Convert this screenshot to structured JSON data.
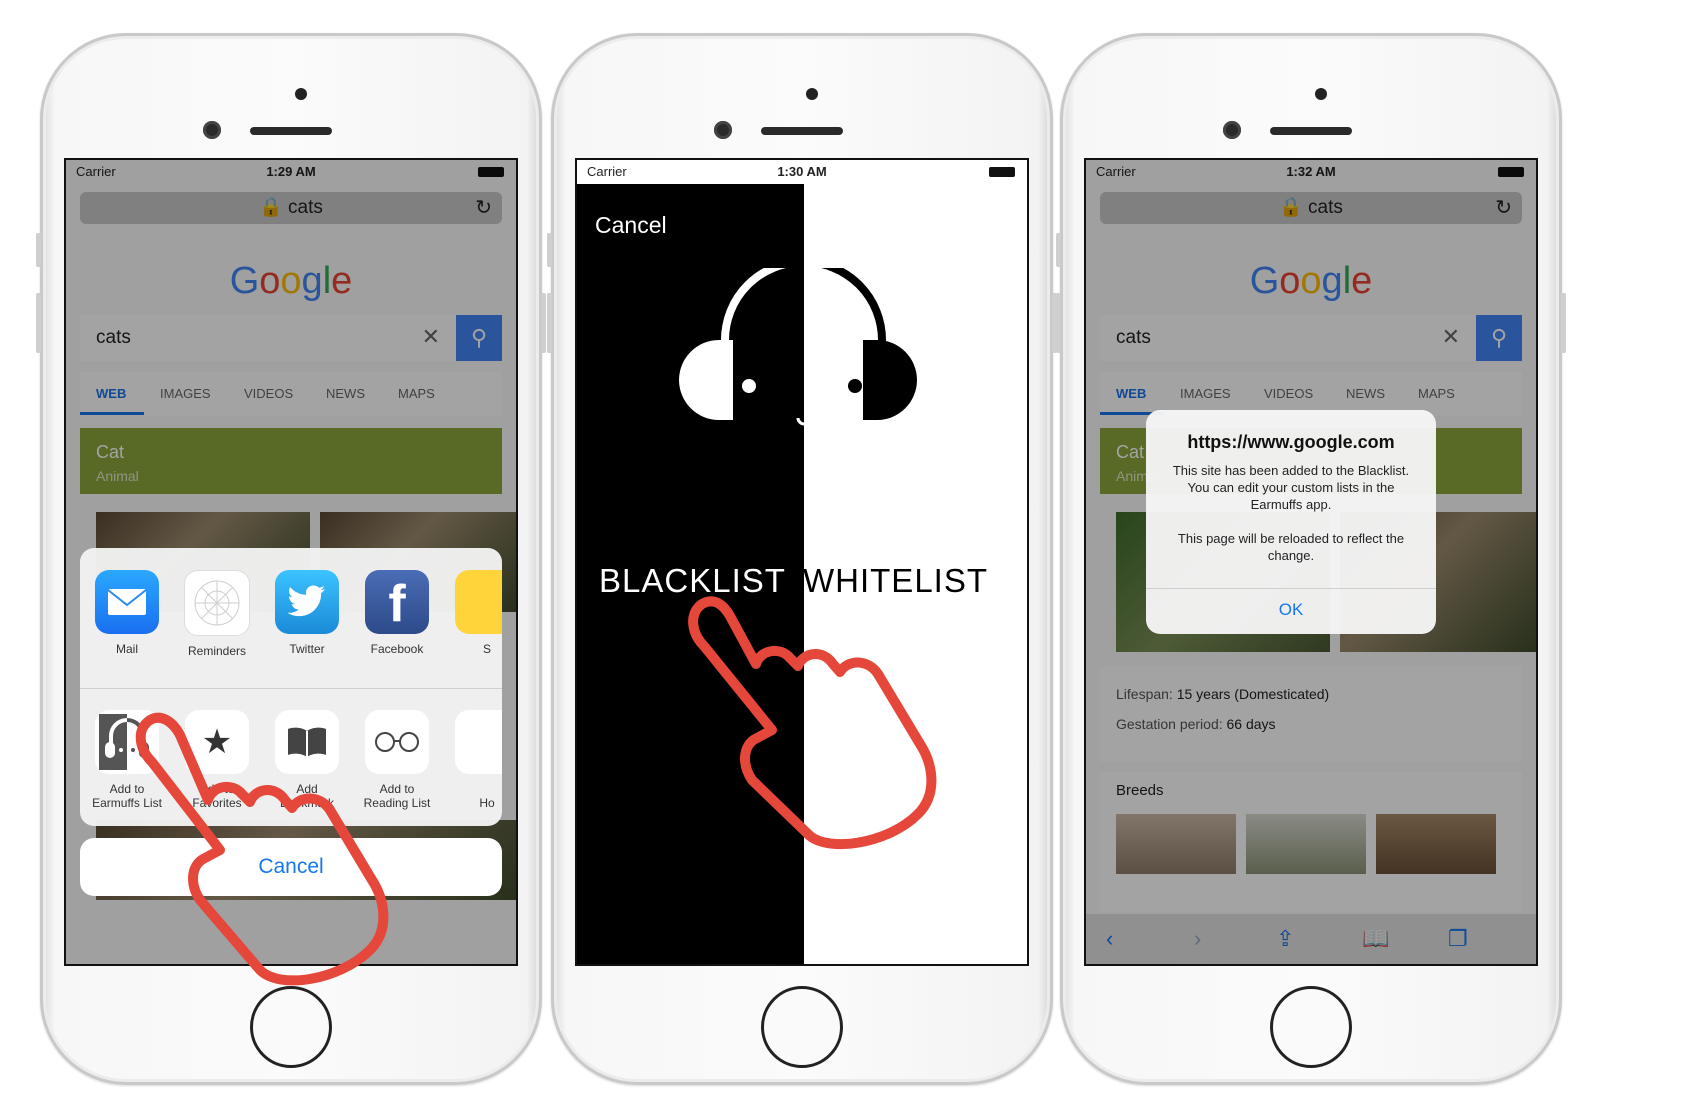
{
  "phone1": {
    "status": {
      "carrier": "Carrier",
      "time": "1:29 AM"
    },
    "url": "cats",
    "logo": "Google",
    "search_value": "cats",
    "tabs": [
      "WEB",
      "IMAGES",
      "VIDEOS",
      "NEWS",
      "MAPS"
    ],
    "knowledge_title": "Cat",
    "knowledge_sub": "Animal",
    "apps": [
      {
        "label": "Mail"
      },
      {
        "label": "Reminders"
      },
      {
        "label": "Twitter"
      },
      {
        "label": "Facebook"
      },
      {
        "label": "S"
      }
    ],
    "actions": [
      {
        "label1": "Add to",
        "label2": "Earmuffs List"
      },
      {
        "label1": "Add to",
        "label2": "Favorites"
      },
      {
        "label1": "Add",
        "label2": "Bookmark"
      },
      {
        "label1": "Add to",
        "label2": "Reading List"
      },
      {
        "label1": "",
        "label2": "Ho"
      }
    ],
    "cancel": "Cancel"
  },
  "phone2": {
    "status": {
      "carrier": "Carrier",
      "time": "1:30 AM"
    },
    "cancel": "Cancel",
    "left_label": "BLACKLIST",
    "right_label": "WHITELIST"
  },
  "phone3": {
    "status": {
      "carrier": "Carrier",
      "time": "1:32 AM"
    },
    "url": "cats",
    "logo": "Google",
    "search_value": "cats",
    "tabs": [
      "WEB",
      "IMAGES",
      "VIDEOS",
      "NEWS",
      "MAPS"
    ],
    "knowledge_title": "Cat",
    "knowledge_sub": "Animal",
    "alert": {
      "title": "https://www.google.com",
      "message": "This site has been added to the Blacklist.  You can edit your custom lists in the Earmuffs app.",
      "message2": "This page will be reloaded to reflect the change.",
      "ok": "OK"
    },
    "lifespan_label": "Lifespan:",
    "lifespan_value": "15 years (Domesticated)",
    "gestation_label": "Gestation period:",
    "gestation_value": "66 days",
    "breeds": "Breeds"
  },
  "colors": {
    "accent": "#1677f0",
    "hand": "#e5473b",
    "google_blue": "#4285f4",
    "knowledge": "#8aa63c"
  }
}
